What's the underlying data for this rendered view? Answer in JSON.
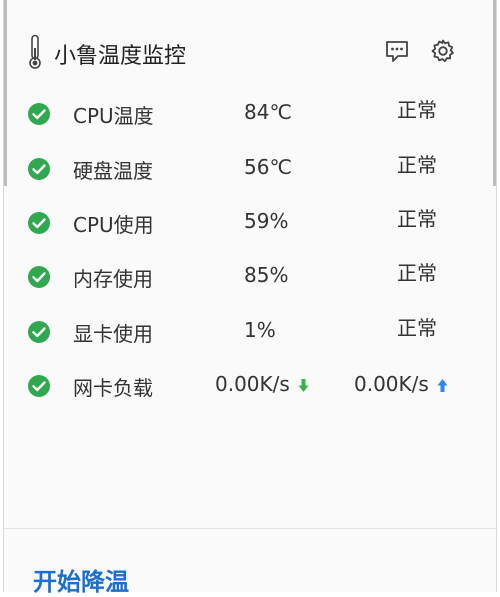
{
  "app": {
    "title": "小鲁温度监控"
  },
  "icons": {
    "app": "thermometer-icon",
    "feedback": "message-icon",
    "settings": "gear-icon",
    "status_ok": "check-circle-icon",
    "download": "arrow-down-icon",
    "upload": "arrow-up-icon"
  },
  "colors": {
    "ok_green": "#2fa84f",
    "download_green": "#35b34a",
    "upload_blue": "#2d8ae8",
    "action_blue": "#1a6fd0"
  },
  "metrics": [
    {
      "label": "CPU温度",
      "value": "84℃",
      "status": "正常"
    },
    {
      "label": "硬盘温度",
      "value": "56℃",
      "status": "正常"
    },
    {
      "label": "CPU使用",
      "value": "59%",
      "status": "正常"
    },
    {
      "label": "内存使用",
      "value": "85%",
      "status": "正常"
    },
    {
      "label": "显卡使用",
      "value": "1%",
      "status": "正常"
    }
  ],
  "network": {
    "label": "网卡负载",
    "download": "0.00K/s",
    "upload": "0.00K/s"
  },
  "actions": {
    "cool_down": "开始降温"
  }
}
